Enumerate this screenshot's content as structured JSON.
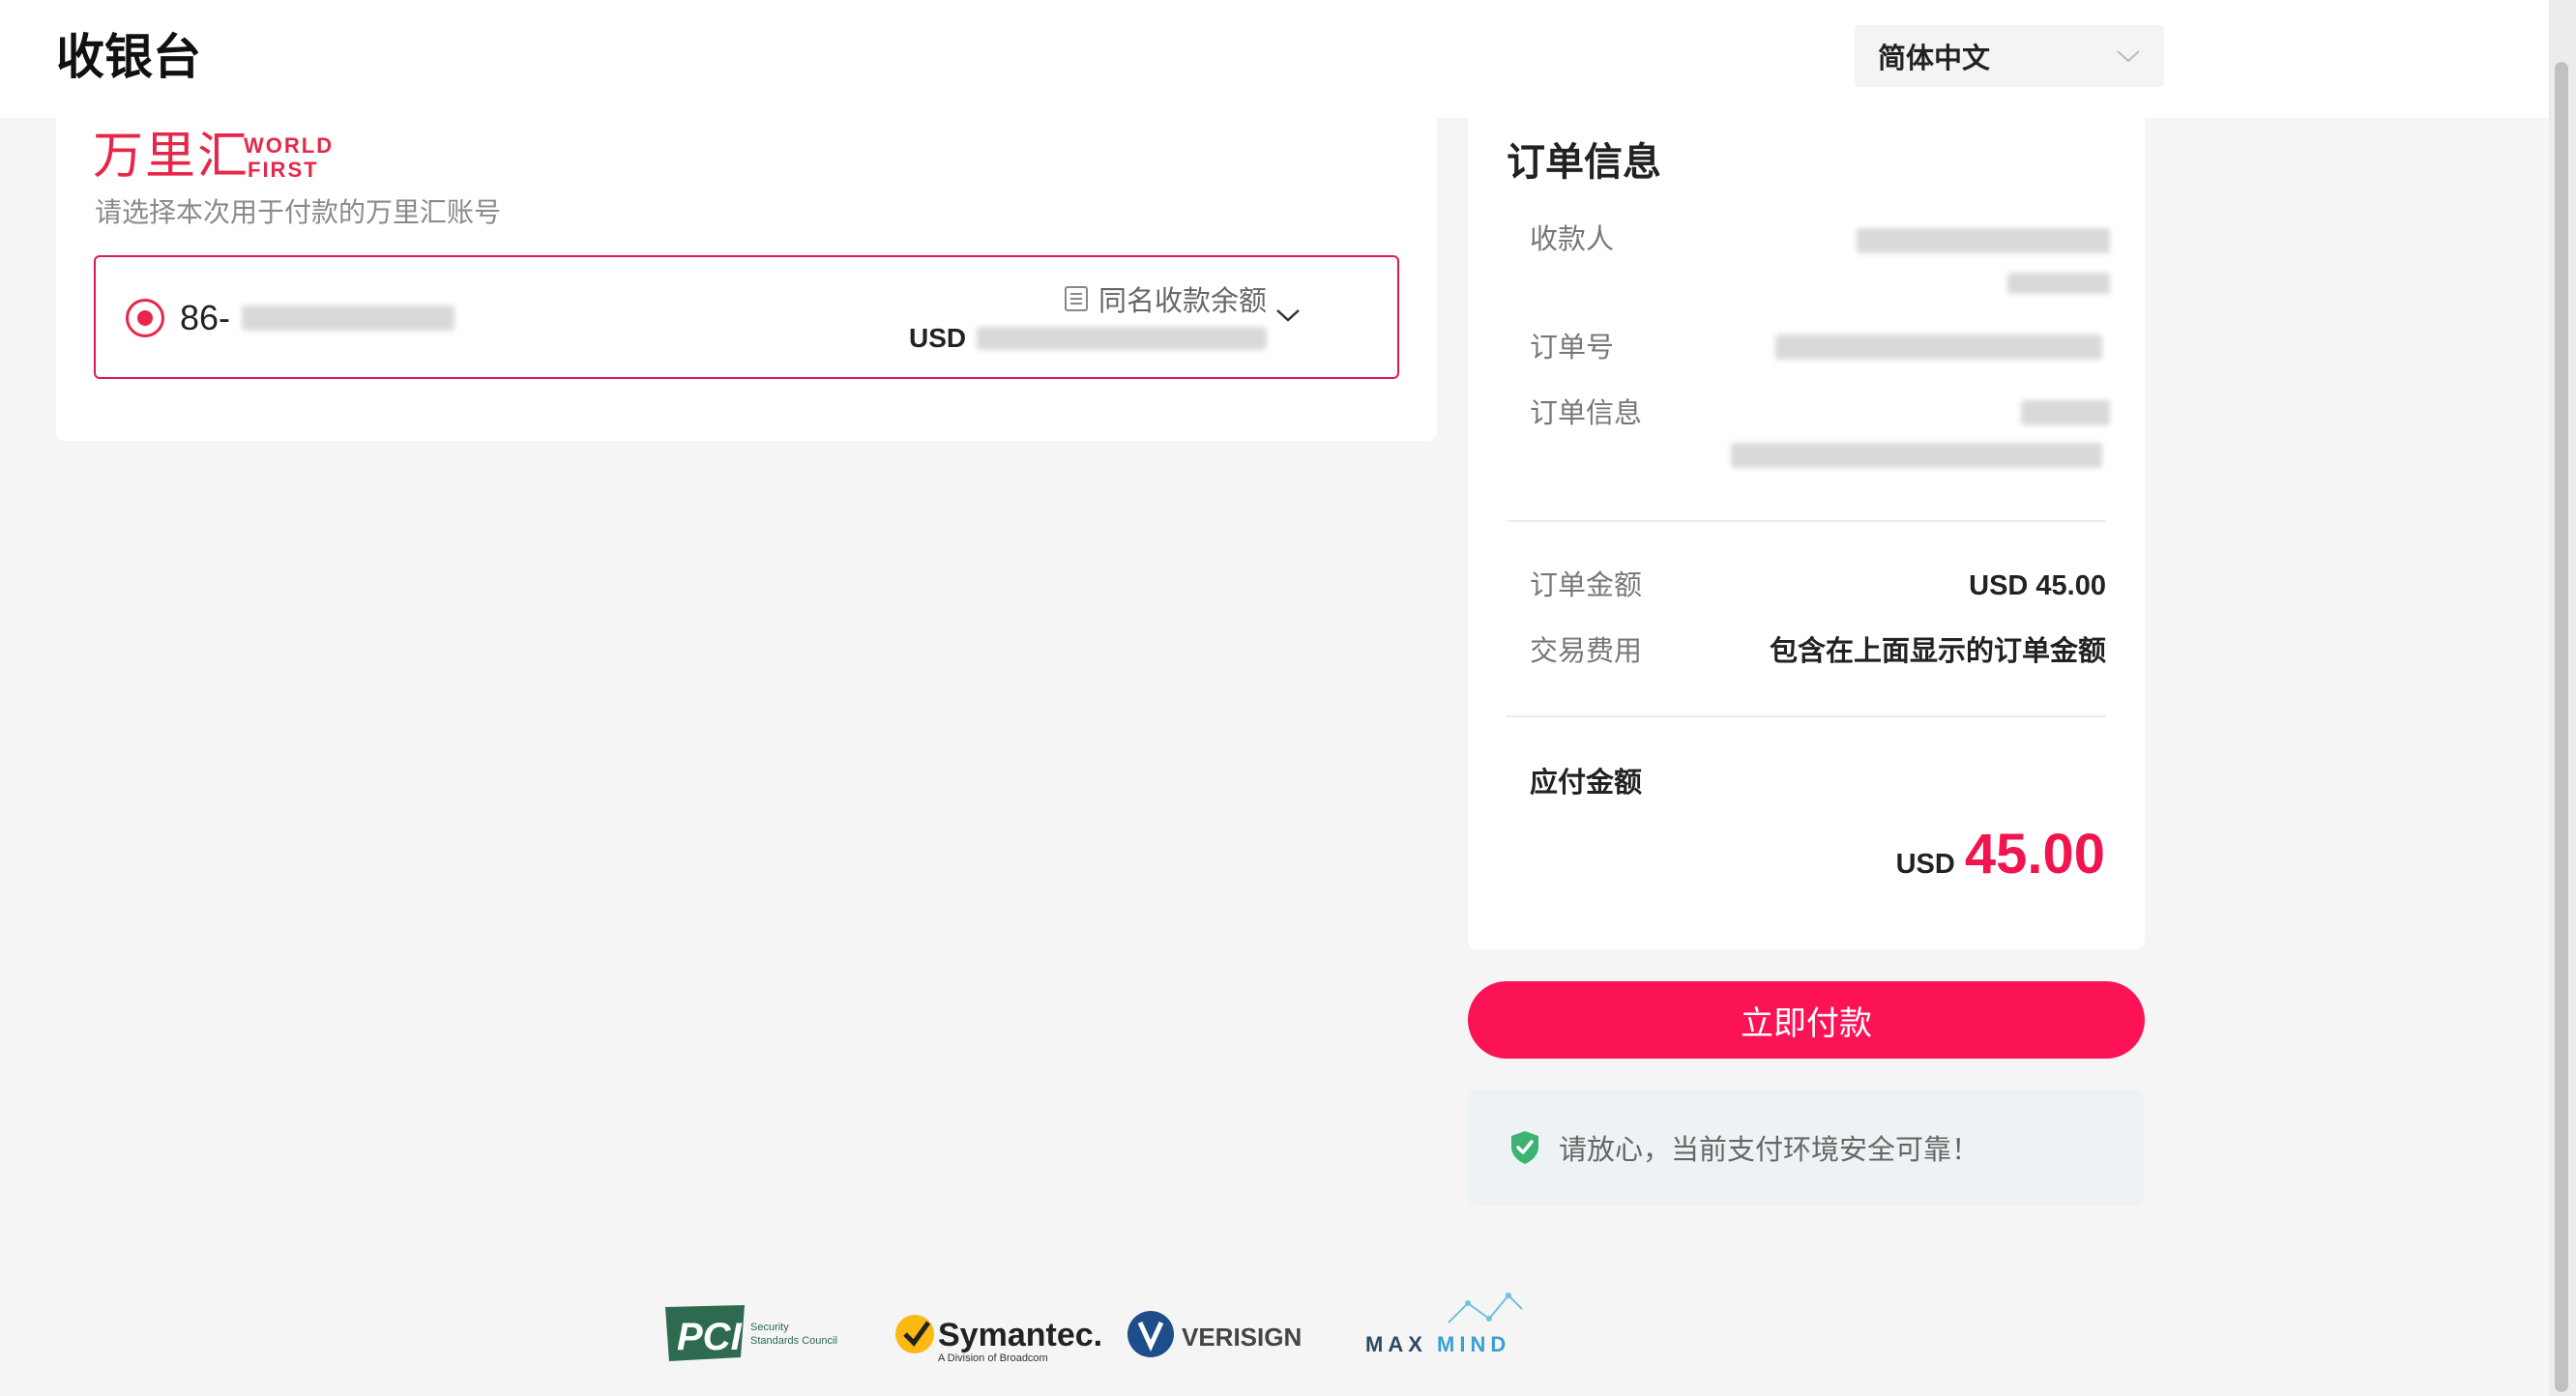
{
  "header": {
    "title": "收银台",
    "language_select": {
      "value": "简体中文"
    }
  },
  "payment_method": {
    "brand_cn": "万里汇",
    "brand_en_line1": "WORLD",
    "brand_en_line2": "FIRST",
    "subtitle": "请选择本次用于付款的万里汇账号",
    "account": {
      "prefix": "86-",
      "balance_label": "同名收款余额",
      "currency": "USD"
    }
  },
  "order": {
    "title": "订单信息",
    "payee_label": "收款人",
    "order_no_label": "订单号",
    "order_info_label": "订单信息",
    "amount_label": "订单金额",
    "amount_value": "USD 45.00",
    "fee_label": "交易费用",
    "fee_value": "包含在上面显示的订单金额",
    "payable_label": "应付金额",
    "payable_currency": "USD",
    "payable_amount": "45.00"
  },
  "actions": {
    "pay_label": "立即付款"
  },
  "security": {
    "notice": "请放心，当前支付环境安全可靠！"
  },
  "trust_logos": {
    "pci_text": "PCI",
    "pci_sub1": "Security",
    "pci_sub2": "Standards Council",
    "symantec": "Symantec.",
    "symantec_sub": "A Division of Broadcom",
    "verisign": "VERISIGN",
    "maxmind_a": "MAX",
    "maxmind_b": "MIND"
  },
  "colors": {
    "accent": "#fb1355",
    "brand_red": "#e8264a",
    "secure_green": "#3cb371"
  }
}
